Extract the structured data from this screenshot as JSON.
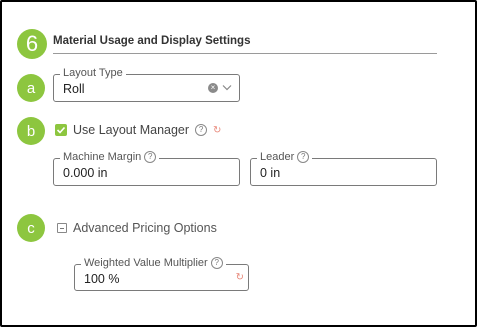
{
  "section": {
    "number": "6",
    "title": "Material Usage and Display Settings"
  },
  "steps": {
    "a": "a",
    "b": "b",
    "c": "c"
  },
  "layout_type": {
    "label": "Layout Type",
    "value": "Roll"
  },
  "use_layout_manager": {
    "label": "Use Layout Manager",
    "checked": true,
    "help": "?"
  },
  "machine_margin": {
    "label": "Machine Margin",
    "value": "0.000 in",
    "help": "?"
  },
  "leader": {
    "label": "Leader",
    "value": "0 in",
    "help": "?"
  },
  "advanced_pricing": {
    "label": "Advanced Pricing Options"
  },
  "weighted_value_multiplier": {
    "label": "Weighted Value Multiplier",
    "value": "100 %",
    "help": "?"
  },
  "colors": {
    "accent": "#8dc63f",
    "reset": "#e8887a"
  }
}
